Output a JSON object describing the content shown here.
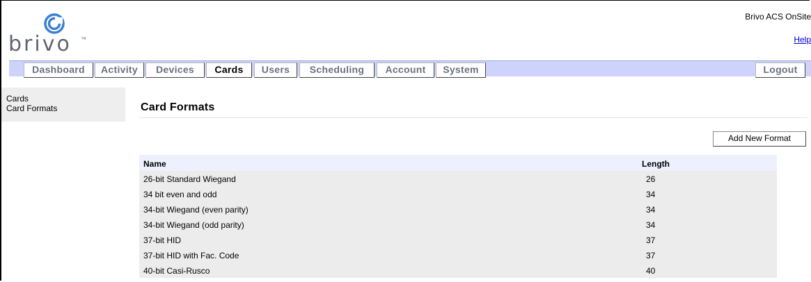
{
  "header": {
    "brand": "brivo",
    "app_name": "Brivo ACS OnSite",
    "help_label": "Help"
  },
  "nav": {
    "tabs": [
      {
        "label": "Dashboard"
      },
      {
        "label": "Activity"
      },
      {
        "label": "Devices"
      },
      {
        "label": "Cards",
        "active": true
      },
      {
        "label": "Users"
      },
      {
        "label": "Scheduling"
      },
      {
        "label": "Account"
      },
      {
        "label": "System"
      }
    ],
    "logout_label": "Logout"
  },
  "sidebar": {
    "items": [
      {
        "label": "Cards"
      },
      {
        "label": "Card Formats"
      }
    ]
  },
  "main": {
    "title": "Card Formats",
    "add_button_label": "Add New Format",
    "table": {
      "columns": [
        "Name",
        "Length"
      ],
      "rows": [
        {
          "name": "26-bit Standard Wiegand",
          "length": "26"
        },
        {
          "name": "34 bit even and odd",
          "length": "34"
        },
        {
          "name": "34-bit Wiegand (even parity)",
          "length": "34"
        },
        {
          "name": "34-bit Wiegand (odd parity)",
          "length": "34"
        },
        {
          "name": "37-bit HID",
          "length": "37"
        },
        {
          "name": "37-bit HID with Fac. Code",
          "length": "37"
        },
        {
          "name": "40-bit Casi-Rusco",
          "length": "40"
        }
      ]
    }
  },
  "colors": {
    "nav_bar": "#cdd3fb",
    "logo_blue": "#3a7fd0",
    "link": "#0000cc"
  }
}
